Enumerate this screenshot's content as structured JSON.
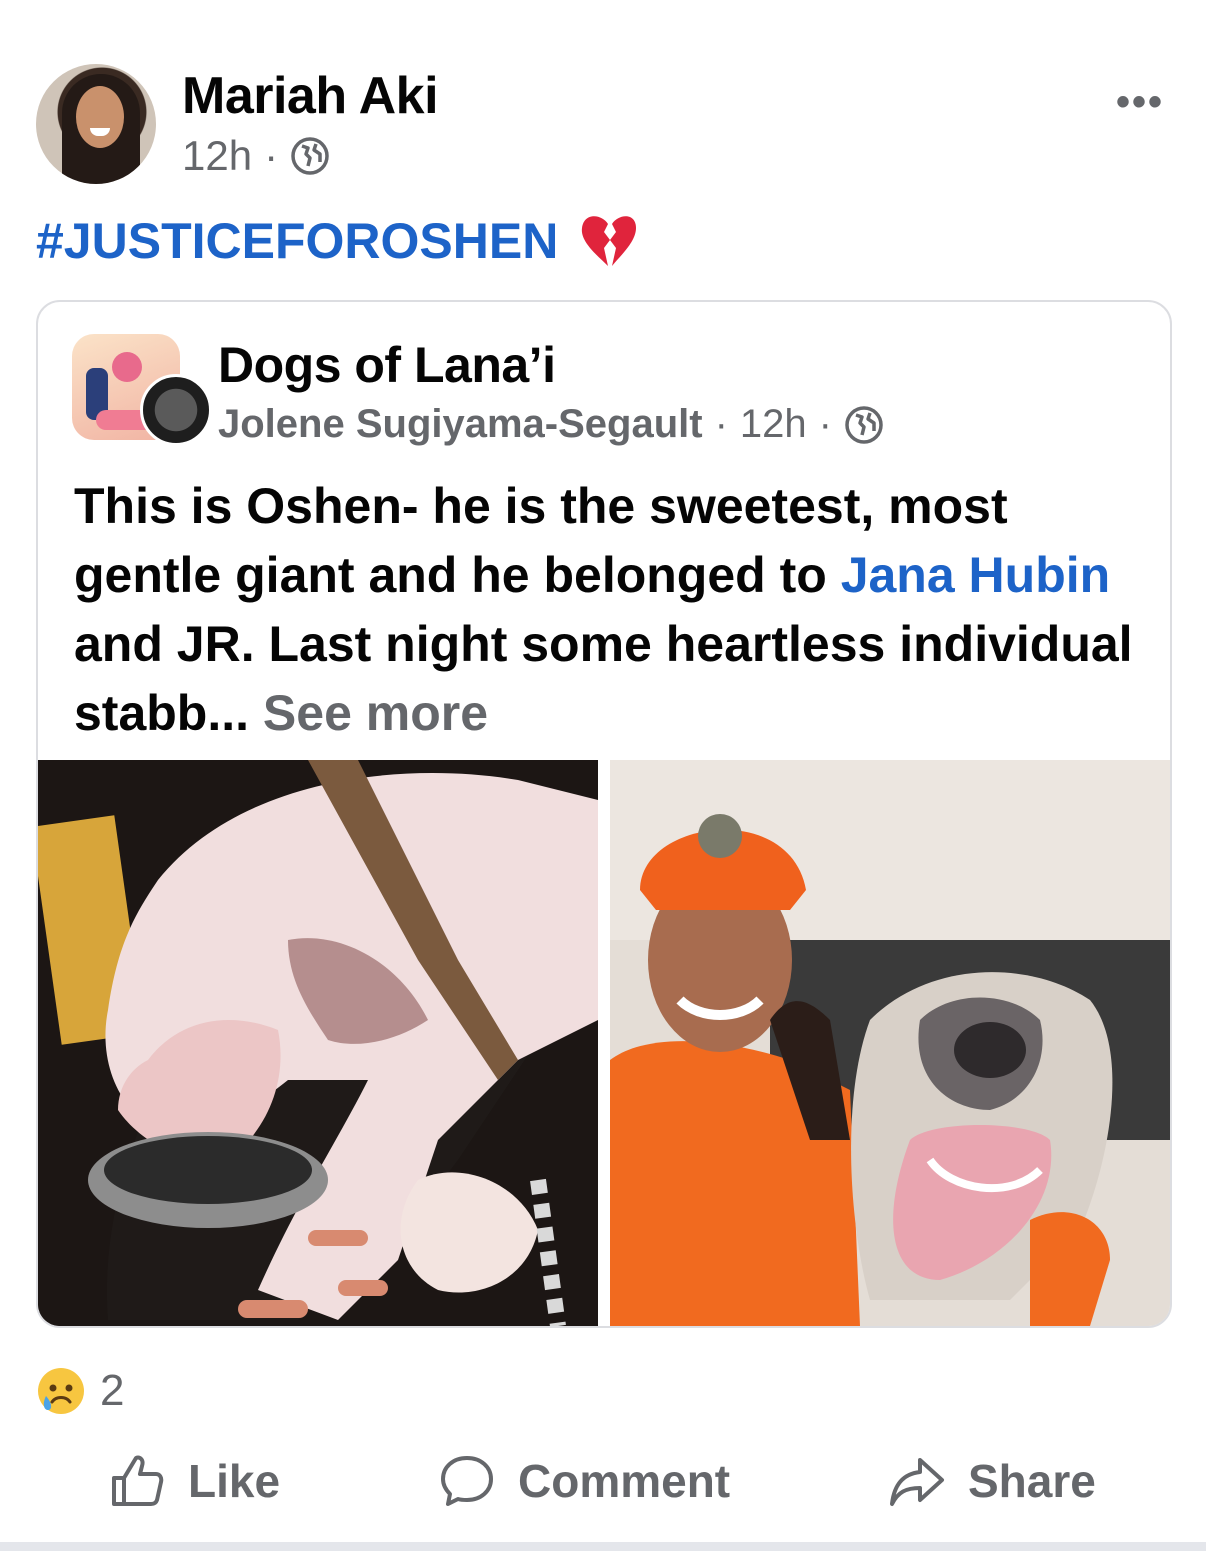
{
  "post": {
    "author": "Mariah Aki",
    "time": "12h",
    "separator": "·",
    "hashtag": "#JUSTICEFOROSHEN",
    "more_label": "•••"
  },
  "shared": {
    "group_name": "Dogs of Lana’i",
    "author": "Jolene Sugiyama-Segault",
    "separator": "·",
    "time": "12h",
    "separator2": "·",
    "text_part1": "This is Oshen- he is the sweetest, most gentle giant and he belonged to ",
    "mention": "Jana Hubin",
    "text_part2": " and JR. Last night some heartless individual stabb... ",
    "see_more": "See more"
  },
  "reactions": {
    "count": "2",
    "icon": "sad-emoji"
  },
  "actions": {
    "like": "Like",
    "comment": "Comment",
    "share": "Share"
  },
  "colors": {
    "link": "#1d63c8",
    "secondary": "#65676b",
    "text": "#050505"
  }
}
